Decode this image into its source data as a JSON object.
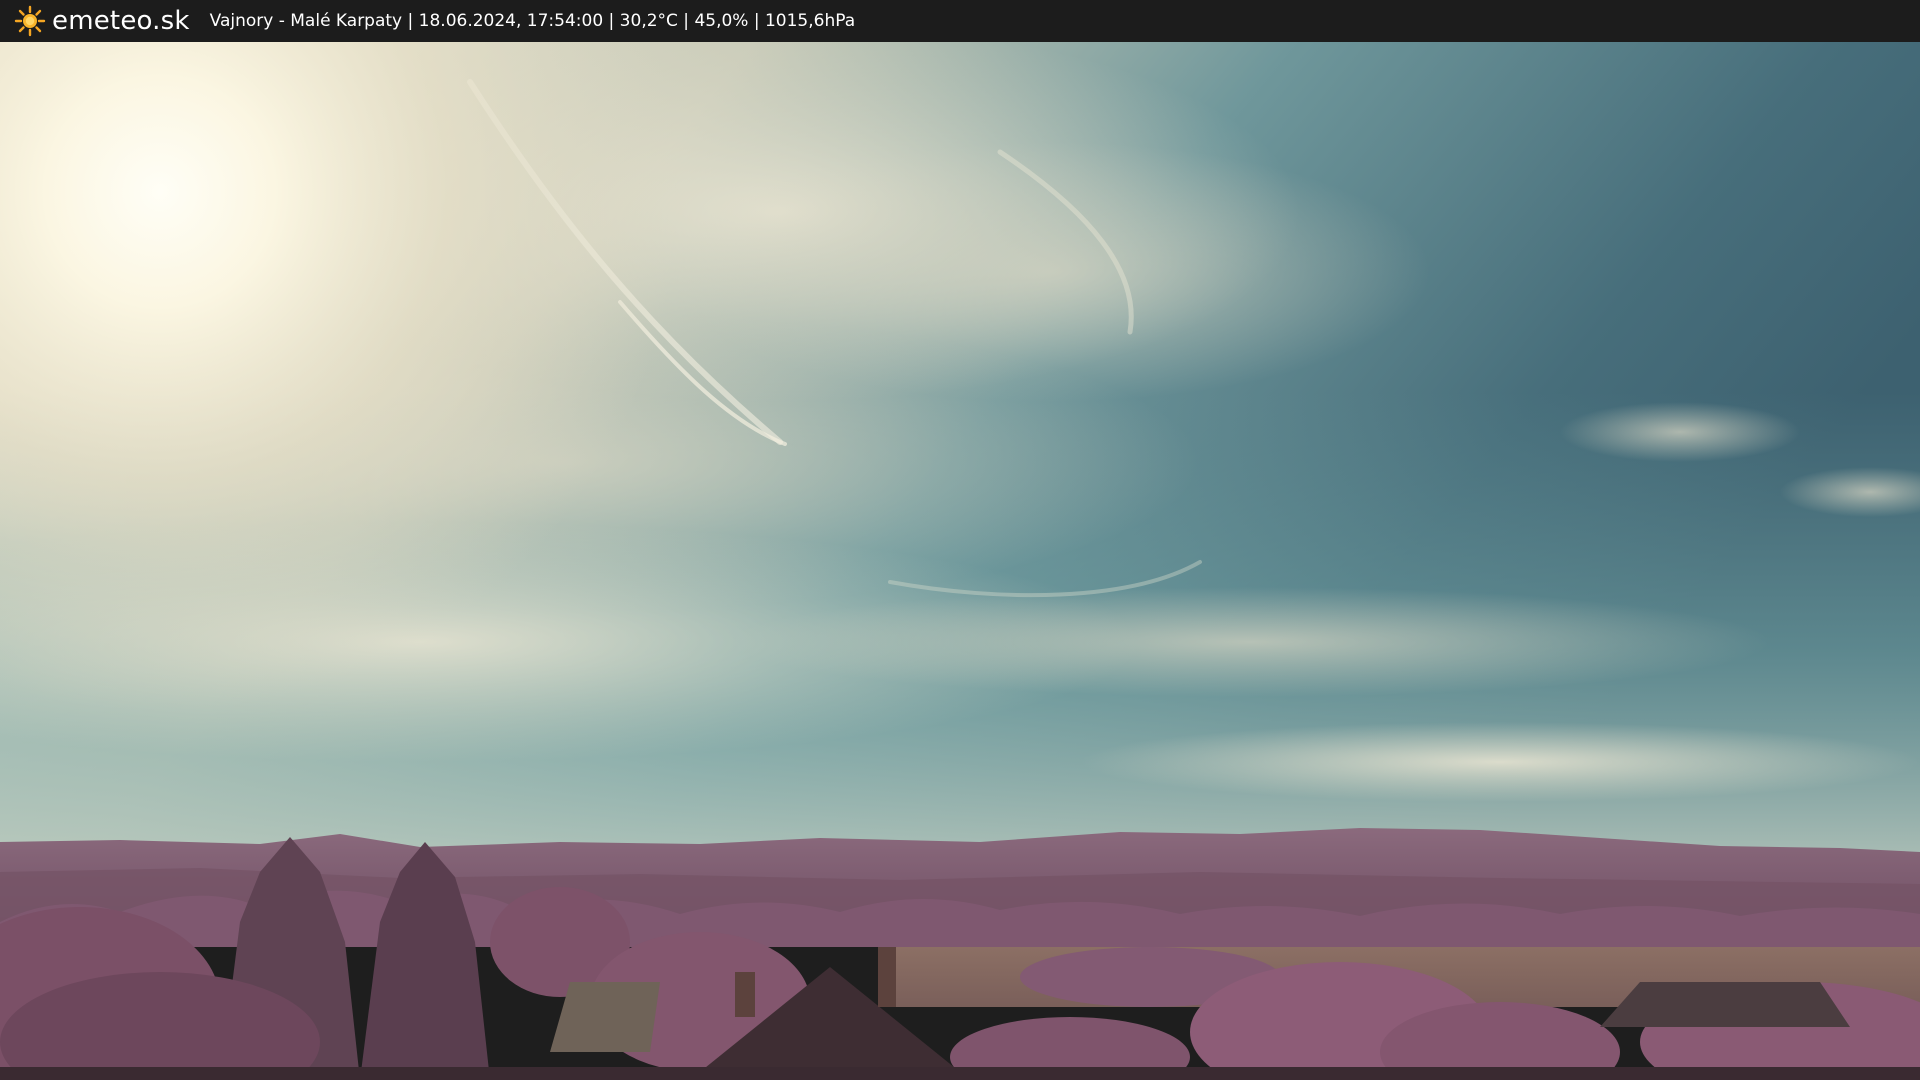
{
  "header": {
    "brand_name": "emeteo.sk",
    "brand_icon": "sun-icon",
    "station_info": "Vajnory - Malé Karpaty | 18.06.2024, 17:54:00 | 30,2°C | 45,0% | 1015,6hPa"
  },
  "colors": {
    "header_bg": "#1c1c1c",
    "brand_sun": "#f5a623",
    "sky_top": "#3a5f6e",
    "sky_teal": "#5d8f96",
    "sun_glow": "#fffbe8",
    "hills": "#7d5a6e",
    "foliage": "#8a5a72"
  }
}
